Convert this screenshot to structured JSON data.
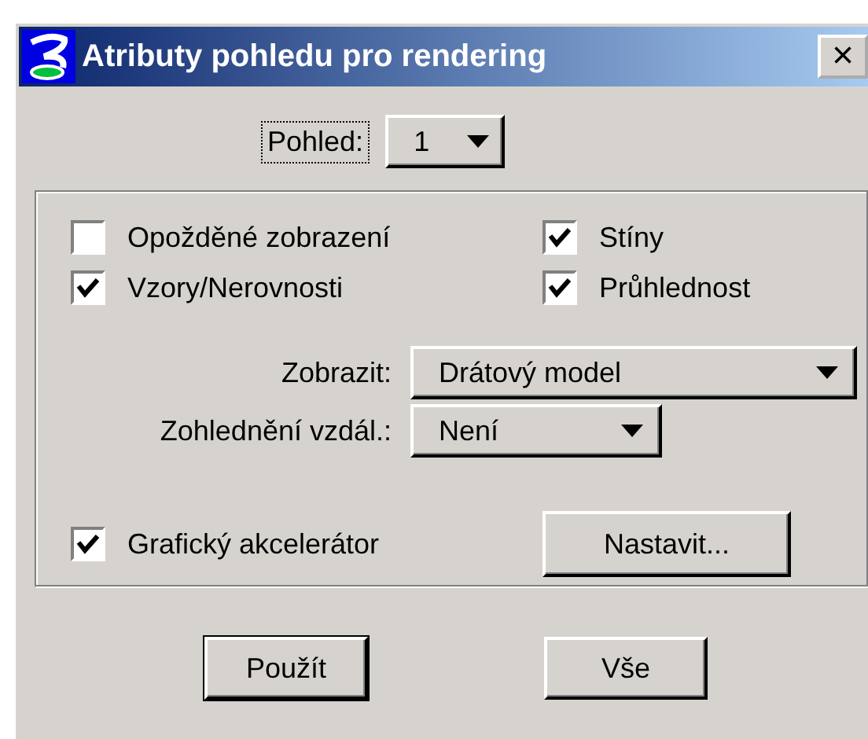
{
  "window": {
    "title": "Atributy pohledu pro rendering",
    "close": "×"
  },
  "view": {
    "label": "Pohled:",
    "value": "1"
  },
  "checkboxes": [
    {
      "label": "Opožděné zobrazení",
      "checked": false
    },
    {
      "label": "Stíny",
      "checked": true
    },
    {
      "label": "Vzory/Nerovnosti",
      "checked": true
    },
    {
      "label": "Průhlednost",
      "checked": true
    }
  ],
  "dropdowns": [
    {
      "label": "Zobrazit:",
      "value": "Drátový model",
      "kind": "wide"
    },
    {
      "label": "Zohlednění vzdál.:",
      "value": "Není",
      "kind": "narrow"
    }
  ],
  "accelerator": {
    "label": "Grafický akcelerátor",
    "checked": true,
    "button": "Nastavit..."
  },
  "buttons": [
    "Použít",
    "Vše"
  ]
}
